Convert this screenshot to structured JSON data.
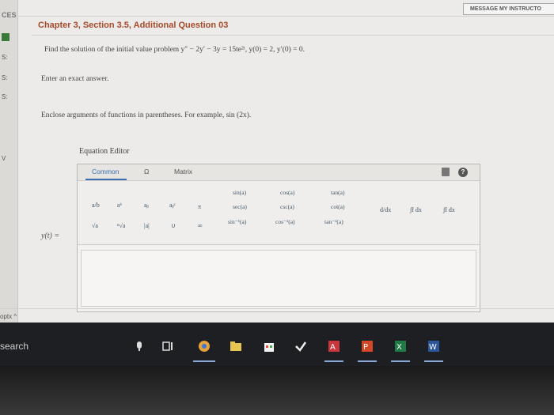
{
  "header": {
    "left_label": "CES",
    "message_button": "MESSAGE MY INSTRUCTO",
    "title": "Chapter 3, Section 3.5, Additional Question 03"
  },
  "question": {
    "prompt": "Find the solution of the initial value problem y″ − 2y′ − 3y = 15te²ᵗ, y(0) = 2, y′(0) = 0.",
    "exact": "Enter an exact answer.",
    "enclose": "Enclose arguments of functions in parentheses. For example, sin (2x)."
  },
  "editor": {
    "label": "Equation Editor",
    "tabs": [
      "Common",
      "Ω",
      "Matrix"
    ],
    "palette_row1": [
      "a/b",
      "aᵇ",
      "aᵦ",
      "aᵦᶜ",
      "π"
    ],
    "palette_row2": [
      "√a",
      "ⁿ√a",
      "|a|",
      "∪",
      "∞"
    ],
    "trig_col1": [
      "sin(a)",
      "sec(a)",
      "sin⁻¹(a)"
    ],
    "trig_col2": [
      "cos(a)",
      "csc(a)",
      "cos⁻¹(a)"
    ],
    "trig_col3": [
      "tan(a)",
      "cot(a)",
      "tan⁻¹(a)"
    ],
    "deriv": "d/dx",
    "integral": "∫f dx",
    "def_integral": "∫f dx",
    "input_label": "y(t) ="
  },
  "sidebar": {
    "items": [
      "S:",
      "S:",
      "S:",
      "V"
    ]
  },
  "footer": {
    "optx": "optx ^",
    "search": "search"
  }
}
